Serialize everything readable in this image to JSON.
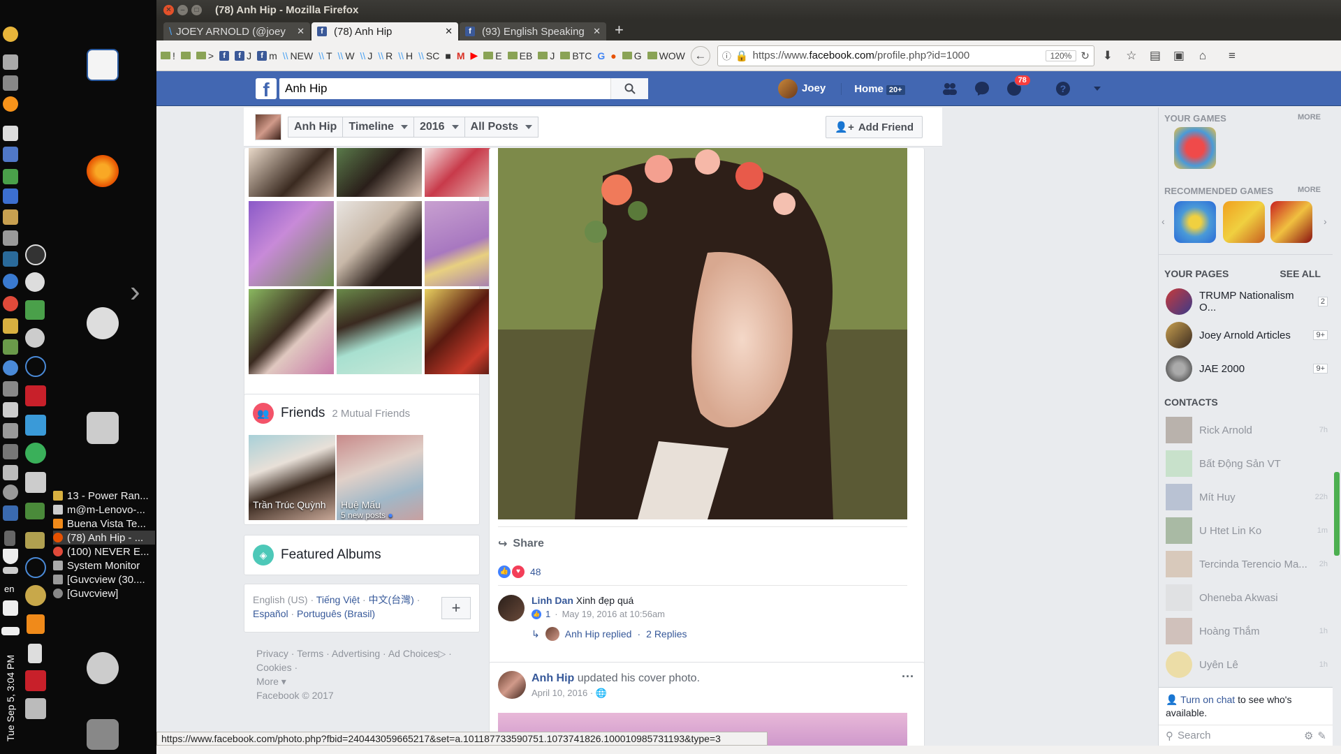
{
  "window": {
    "title": "(78) Anh Hip - Mozilla Firefox"
  },
  "tabs": [
    {
      "label": "JOEY ARNOLD (@joey",
      "active": false
    },
    {
      "label": "(78) Anh Hip",
      "active": true
    },
    {
      "label": "(93) English Speaking",
      "active": false
    }
  ],
  "bookmarks": [
    "!",
    ">",
    "J",
    "m",
    "NEW",
    "T",
    "W",
    "J",
    "R",
    "H",
    "SC",
    "E",
    "EB",
    "J",
    "BTC",
    "G",
    "G",
    "WOW"
  ],
  "urlbar": {
    "url_prefix": "https://www.",
    "url_domain": "facebook.com",
    "url_rest": "/profile.php?id=1000",
    "zoom": "120%"
  },
  "dock": {
    "tasks": [
      {
        "label": "13 - Power Ran...",
        "active": false
      },
      {
        "label": "m@m-Lenovo-...",
        "active": false
      },
      {
        "label": "Buena Vista Te...",
        "active": false
      },
      {
        "label": "(78) Anh Hip - ...",
        "active": true
      },
      {
        "label": "(100) NEVER E...",
        "active": false
      },
      {
        "label": "System Monitor",
        "active": false
      },
      {
        "label": "[Guvcview (30....",
        "active": false
      },
      {
        "label": "[Guvcview]",
        "active": false
      }
    ],
    "lang": "en",
    "clock": "Tue Sep 5, 3:04 PM"
  },
  "fb": {
    "search_value": "Anh Hip",
    "user": "Joey",
    "home_label": "Home",
    "home_badge": "20+",
    "notif_count": "78",
    "timeline": {
      "name": "Anh Hip",
      "timeline_label": "Timeline",
      "year": "2016",
      "filter": "All Posts",
      "add_friend": "Add Friend"
    },
    "friends": {
      "title": "Friends",
      "mutual": "2 Mutual Friends",
      "list": [
        {
          "name": "Trần Trúc Quỳnh",
          "sub": ""
        },
        {
          "name": "Huệ Mấu",
          "sub": "5 new posts"
        }
      ]
    },
    "albums_title": "Featured Albums",
    "languages": {
      "current": "English (US)",
      "others": [
        "Tiếng Việt",
        "中文(台灣)",
        "Español",
        "Português (Brasil)"
      ]
    },
    "footer": {
      "links": [
        "Privacy",
        "Terms",
        "Advertising",
        "Ad Choices",
        "Cookies"
      ],
      "more": "More",
      "copyright": "Facebook © 2017"
    },
    "post": {
      "share_label": "Share",
      "reaction_count": "48",
      "comment": {
        "author": "Linh Dan",
        "text": "Xinh đẹp quá",
        "likes": "1",
        "time": "May 19, 2016 at 10:56am",
        "reply_author": "Anh Hip replied",
        "replies": "2 Replies"
      }
    },
    "post2": {
      "author": "Anh Hip",
      "action": "updated his cover photo.",
      "date": "April 10, 2016"
    },
    "sidebar": {
      "your_games": "YOUR GAMES",
      "more": "MORE",
      "recommended_games": "RECOMMENDED GAMES",
      "your_pages": "YOUR PAGES",
      "see_all": "SEE ALL",
      "pages": [
        {
          "name": "TRUMP Nationalism O...",
          "count": "2"
        },
        {
          "name": "Joey Arnold Articles",
          "count": "9+"
        },
        {
          "name": "JAE 2000",
          "count": "9+"
        }
      ],
      "contacts_title": "CONTACTS",
      "contacts": [
        {
          "name": "Rick Arnold",
          "time": "7h"
        },
        {
          "name": "Bất Động Sản VT",
          "time": ""
        },
        {
          "name": "Mít Huy",
          "time": "22h"
        },
        {
          "name": "U Htet Lin Ko",
          "time": "1m"
        },
        {
          "name": "Tercinda Terencio Ma...",
          "time": "2h"
        },
        {
          "name": "Oheneba Akwasi",
          "time": ""
        },
        {
          "name": "Hoàng Thắm",
          "time": "1h"
        },
        {
          "name": "Uyên Lê",
          "time": "1h"
        }
      ],
      "chat_link": "Turn on chat",
      "chat_text": "to see who's available.",
      "chat_search": "Search"
    }
  },
  "statusbar": "https://www.facebook.com/photo.php?fbid=240443059665217&set=a.101187733590751.1073741826.100010985731193&type=3"
}
